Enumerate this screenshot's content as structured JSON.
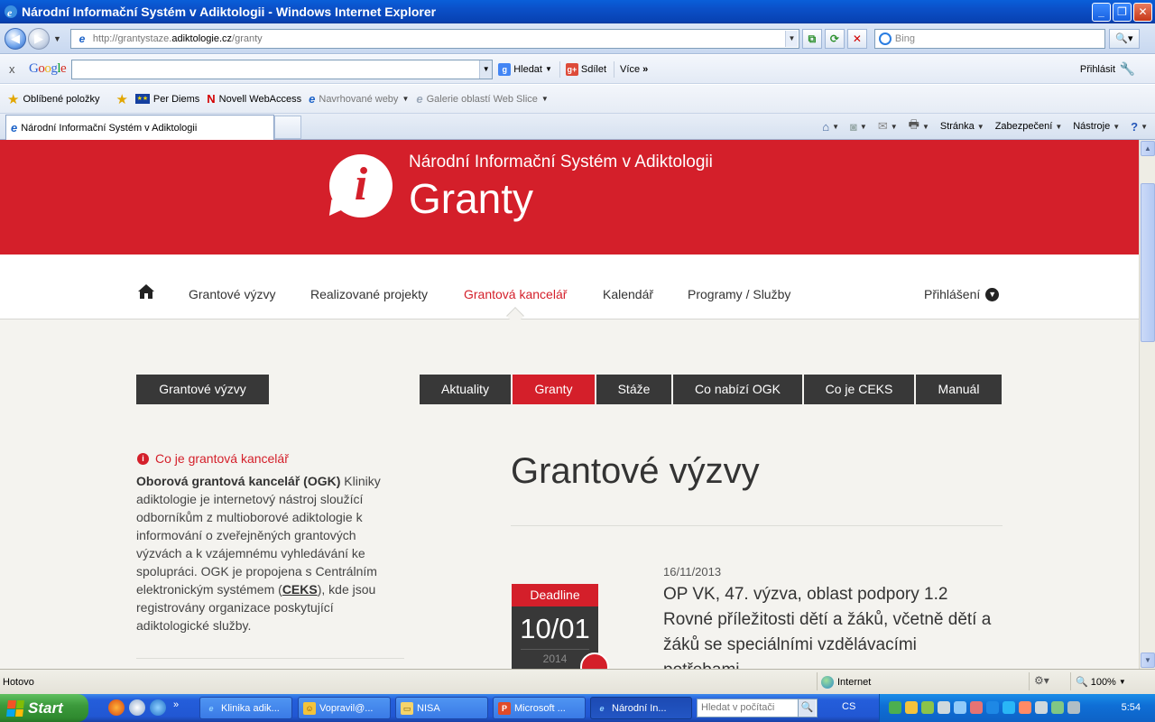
{
  "window": {
    "title": "Národní Informační Systém v Adiktologii - Windows Internet Explorer",
    "buttons": [
      "minimize",
      "maximize",
      "close"
    ]
  },
  "address_bar": {
    "url_prefix": "http://grantystaze.",
    "url_domain": "adiktologie.cz",
    "url_path": "/granty",
    "search_placeholder": "Bing"
  },
  "google_toolbar": {
    "close": "x",
    "logo": "Google",
    "search_label": "Hledat",
    "share_label": "Sdílet",
    "more_label": "Více",
    "sign_in": "Přihlásit"
  },
  "favorites_bar": {
    "favorites_label": "Oblíbené položky",
    "items": [
      "Per Diems",
      "Novell WebAccess",
      "Navrhované weby",
      "Galerie oblastí Web Slice"
    ]
  },
  "tabs": {
    "active_title": "Národní Informační Systém v Adiktologii"
  },
  "command_bar": {
    "page": "Stránka",
    "security": "Zabezpečení",
    "tools": "Nástroje"
  },
  "site": {
    "subtitle": "Národní Informační Systém v Adiktologii",
    "title": "Granty",
    "nav": [
      "Grantové výzvy",
      "Realizované projekty",
      "Grantová kancelář",
      "Kalendář",
      "Programy / Služby"
    ],
    "nav_active": "Grantová kancelář",
    "login": "Přihlášení",
    "side_button": "Grantové výzvy",
    "subtabs": [
      "Aktuality",
      "Granty",
      "Stáže",
      "Co nabízí OGK",
      "Co je CEKS",
      "Manuál"
    ],
    "subtab_active": "Granty",
    "sidebar": {
      "heading": "Co je grantová kancelář",
      "bold_lead": "Oborová grantová kancelář (OGK)",
      "text_1": " Kliniky adiktologie je internetový nástroj sloužící odborníkům z multioborové adiktologie k informování o zveřejněných grantových výzvách a k vzájemnému vyhledávání ke spolupráci. OGK je propojena s Centrálním elektronickým systémem (",
      "link": "CEKS",
      "text_2": "), kde jsou registrovány organizace poskytující adiktologické služby."
    },
    "page_heading": "Grantové výzvy",
    "post": {
      "date": "16/11/2013",
      "title": "OP VK, 47. výzva, oblast podpory 1.2 Rovné příležitosti dětí a žáků, včetně dětí a žáků se speciálními vzdělávacími potřebami",
      "deadline_label": "Deadline",
      "deadline_date": "10/01",
      "deadline_year": "2014"
    }
  },
  "status_bar": {
    "status": "Hotovo",
    "zone": "Internet",
    "zoom": "100%"
  },
  "taskbar": {
    "start": "Start",
    "buttons": [
      "Klinika adik...",
      "Vopravil@...",
      "NISA",
      "Microsoft ...",
      "Národní In..."
    ],
    "search_placeholder": "Hledat v počítači",
    "lang": "CS",
    "clock": "5:54"
  },
  "colors": {
    "brand_red": "#d41f2a",
    "dark_button": "#383838",
    "xp_blue": "#245edb"
  }
}
